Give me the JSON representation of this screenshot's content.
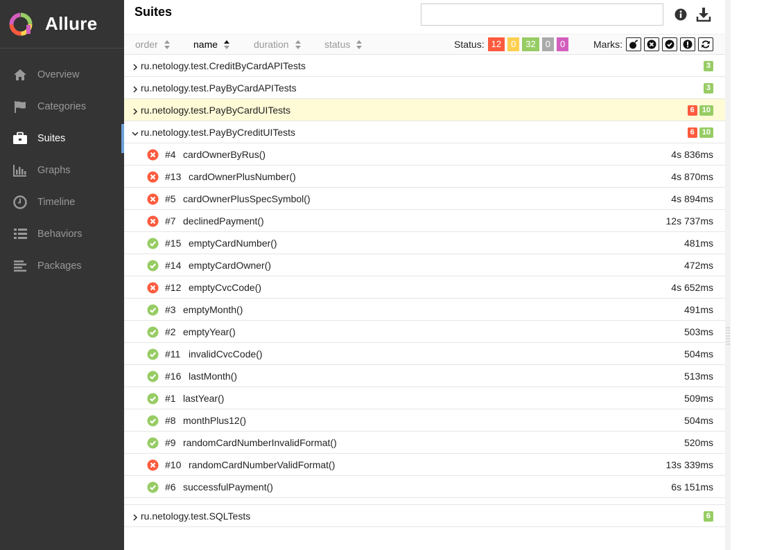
{
  "brand": {
    "name": "Allure"
  },
  "nav": [
    {
      "label": "Overview",
      "icon": "home-icon"
    },
    {
      "label": "Categories",
      "icon": "flag-icon"
    },
    {
      "label": "Suites",
      "icon": "briefcase-icon",
      "active": true
    },
    {
      "label": "Graphs",
      "icon": "bar-chart-icon"
    },
    {
      "label": "Timeline",
      "icon": "clock-icon"
    },
    {
      "label": "Behaviors",
      "icon": "list-icon"
    },
    {
      "label": "Packages",
      "icon": "align-left-icon"
    }
  ],
  "page": {
    "title": "Suites"
  },
  "search": {
    "value": "",
    "placeholder": ""
  },
  "sort": {
    "order": "order",
    "name": "name",
    "duration": "duration",
    "status": "status",
    "active": "name"
  },
  "status_filter": {
    "label": "Status:",
    "counts": [
      {
        "status": "failed",
        "value": "12",
        "color": "#fd5a3e"
      },
      {
        "status": "broken",
        "value": "0",
        "color": "#ffd050"
      },
      {
        "status": "passed",
        "value": "32",
        "color": "#97cc64"
      },
      {
        "status": "skipped",
        "value": "0",
        "color": "#aaaaaa"
      },
      {
        "status": "unknown",
        "value": "0",
        "color": "#d35ebe"
      }
    ]
  },
  "marks": {
    "label": "Marks:",
    "items": [
      "bomb-icon",
      "times-circle-icon",
      "check-circle-icon",
      "exclamation-circle-icon",
      "refresh-icon"
    ]
  },
  "colors": {
    "failed": "#fd5a3e",
    "passed": "#97cc64",
    "sidebar": "#343434",
    "highlight": "#fffbd7",
    "active_marker": "#6ea0d8"
  },
  "suites": [
    {
      "name": "ru.netology.test.CreditByCardAPITests",
      "failed": "",
      "passed": "3",
      "expanded": false,
      "highlighted": false
    },
    {
      "name": "ru.netology.test.PayByCardAPITests",
      "failed": "",
      "passed": "3",
      "expanded": false,
      "highlighted": false
    },
    {
      "name": "ru.netology.test.PayByCardUITests",
      "failed": "6",
      "passed": "10",
      "expanded": false,
      "highlighted": true
    },
    {
      "name": "ru.netology.test.PayByCreditUITests",
      "failed": "6",
      "passed": "10",
      "expanded": true,
      "highlighted": false
    }
  ],
  "tests": [
    {
      "num": "#4",
      "name": "cardOwnerByRus()",
      "duration": "4s 836ms",
      "status": "failed"
    },
    {
      "num": "#13",
      "name": "cardOwnerPlusNumber()",
      "duration": "4s 870ms",
      "status": "failed"
    },
    {
      "num": "#5",
      "name": "cardOwnerPlusSpecSymbol()",
      "duration": "4s 894ms",
      "status": "failed"
    },
    {
      "num": "#7",
      "name": "declinedPayment()",
      "duration": "12s 737ms",
      "status": "failed"
    },
    {
      "num": "#15",
      "name": "emptyCardNumber()",
      "duration": "481ms",
      "status": "passed"
    },
    {
      "num": "#14",
      "name": "emptyCardOwner()",
      "duration": "472ms",
      "status": "passed"
    },
    {
      "num": "#12",
      "name": "emptyCvcCode()",
      "duration": "4s 652ms",
      "status": "failed"
    },
    {
      "num": "#3",
      "name": "emptyMonth()",
      "duration": "491ms",
      "status": "passed"
    },
    {
      "num": "#2",
      "name": "emptyYear()",
      "duration": "503ms",
      "status": "passed"
    },
    {
      "num": "#11",
      "name": "invalidCvcCode()",
      "duration": "504ms",
      "status": "passed"
    },
    {
      "num": "#16",
      "name": "lastMonth()",
      "duration": "513ms",
      "status": "passed"
    },
    {
      "num": "#1",
      "name": "lastYear()",
      "duration": "509ms",
      "status": "passed"
    },
    {
      "num": "#8",
      "name": "monthPlus12()",
      "duration": "504ms",
      "status": "passed"
    },
    {
      "num": "#9",
      "name": "randomCardNumberInvalidFormat()",
      "duration": "520ms",
      "status": "passed"
    },
    {
      "num": "#10",
      "name": "randomCardNumberValidFormat()",
      "duration": "13s 339ms",
      "status": "failed"
    },
    {
      "num": "#6",
      "name": "successfulPayment()",
      "duration": "6s 151ms",
      "status": "passed"
    }
  ],
  "trailing_suites": [
    {
      "name": "ru.netology.test.SQLTests",
      "failed": "",
      "passed": "6",
      "expanded": false,
      "highlighted": false
    }
  ]
}
